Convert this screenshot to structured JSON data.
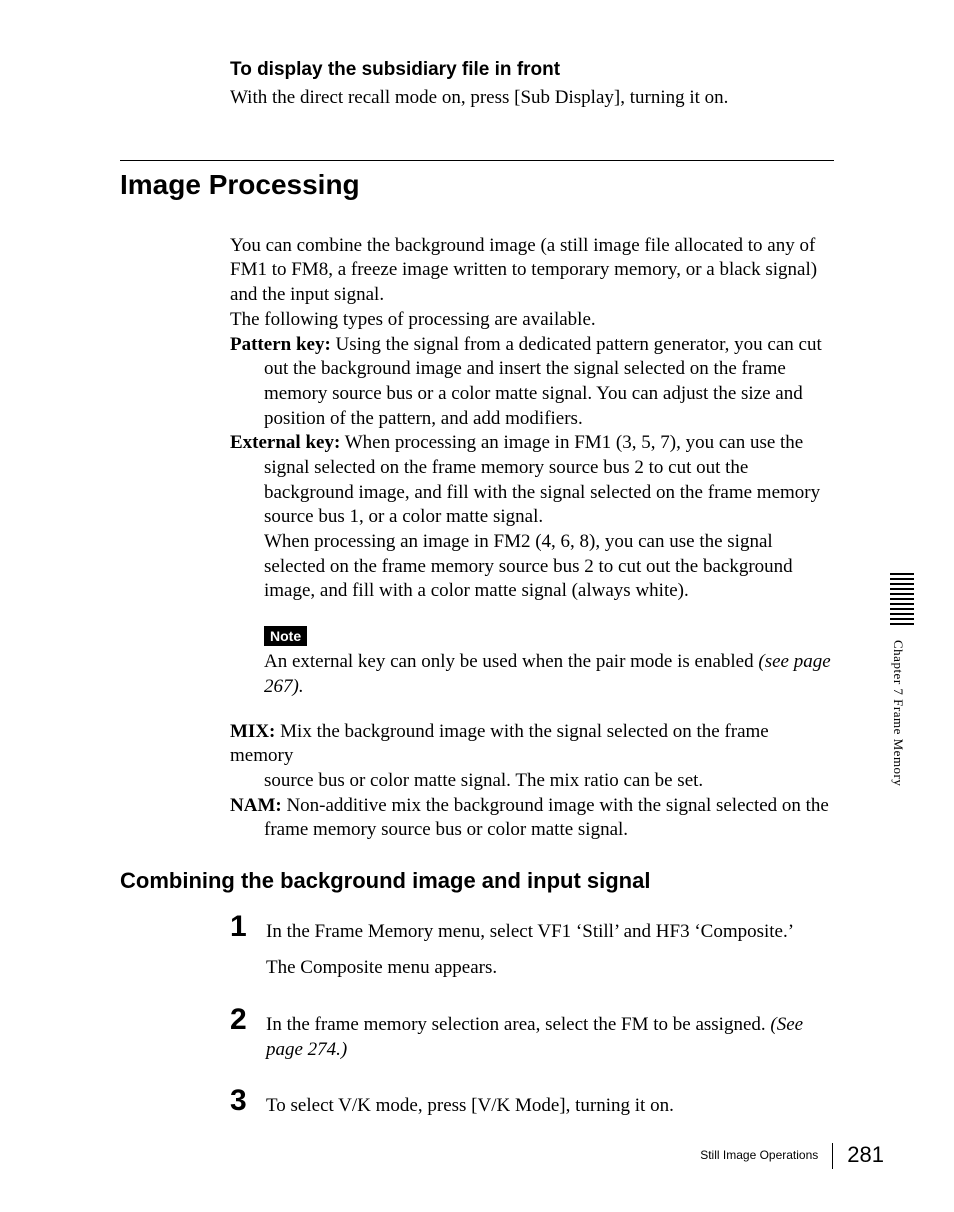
{
  "intro": {
    "heading": "To display the subsidiary file in front",
    "text": "With the direct recall mode on, press [Sub Display], turning it on."
  },
  "section": {
    "title": "Image Processing",
    "para1": "You can combine the background image (a still image file allocated to any of FM1 to FM8, a freeze image written to temporary memory, or a black signal) and the input signal.",
    "para2": "The following types of processing are available.",
    "defs": {
      "pattern_key_term": "Pattern key:",
      "pattern_key_lead": " Using the signal from a dedicated pattern generator, you can cut",
      "pattern_key_body": "out the background image and insert the signal selected on the frame memory source bus or a color matte signal. You can adjust the size and position of the pattern, and add modifiers.",
      "external_key_term": "External key:",
      "external_key_lead": " When processing an image in FM1 (3, 5, 7), you can use the",
      "external_key_body1": "signal selected on the frame memory source bus 2 to cut out the background image, and fill with the signal selected on the frame memory source bus 1, or a color matte signal.",
      "external_key_body2": "When processing an image in FM2 (4, 6, 8), you can use the signal selected on the frame memory source bus 2 to cut out the background image, and fill with a color matte signal (always white).",
      "mix_term": "MIX:",
      "mix_lead": " Mix the background image with the signal selected on the frame memory",
      "mix_body": "source bus or color matte signal. The mix ratio can be set.",
      "nam_term": "NAM:",
      "nam_lead": " Non-additive mix the background image with the signal selected on the",
      "nam_body": "frame memory source bus or color matte signal."
    },
    "note": {
      "label": "Note",
      "text_a": "An external key can only be used when the pair mode is enabled ",
      "text_b": "(see page 267)."
    }
  },
  "subsection": {
    "title": "Combining the background image and input signal",
    "steps": [
      {
        "num": "1",
        "line1": "In the Frame Memory menu, select VF1 ‘Still’ and HF3 ‘Composite.’",
        "line2": "The Composite menu appears."
      },
      {
        "num": "2",
        "line1_a": "In the frame memory selection area, select the FM to be assigned. ",
        "line1_b": "(See page 274.)"
      },
      {
        "num": "3",
        "line1": "To select V/K mode, press [V/K Mode], turning it on."
      }
    ]
  },
  "side": {
    "label": "Chapter 7  Frame Memory"
  },
  "footer": {
    "section": "Still Image Operations",
    "page": "281"
  }
}
